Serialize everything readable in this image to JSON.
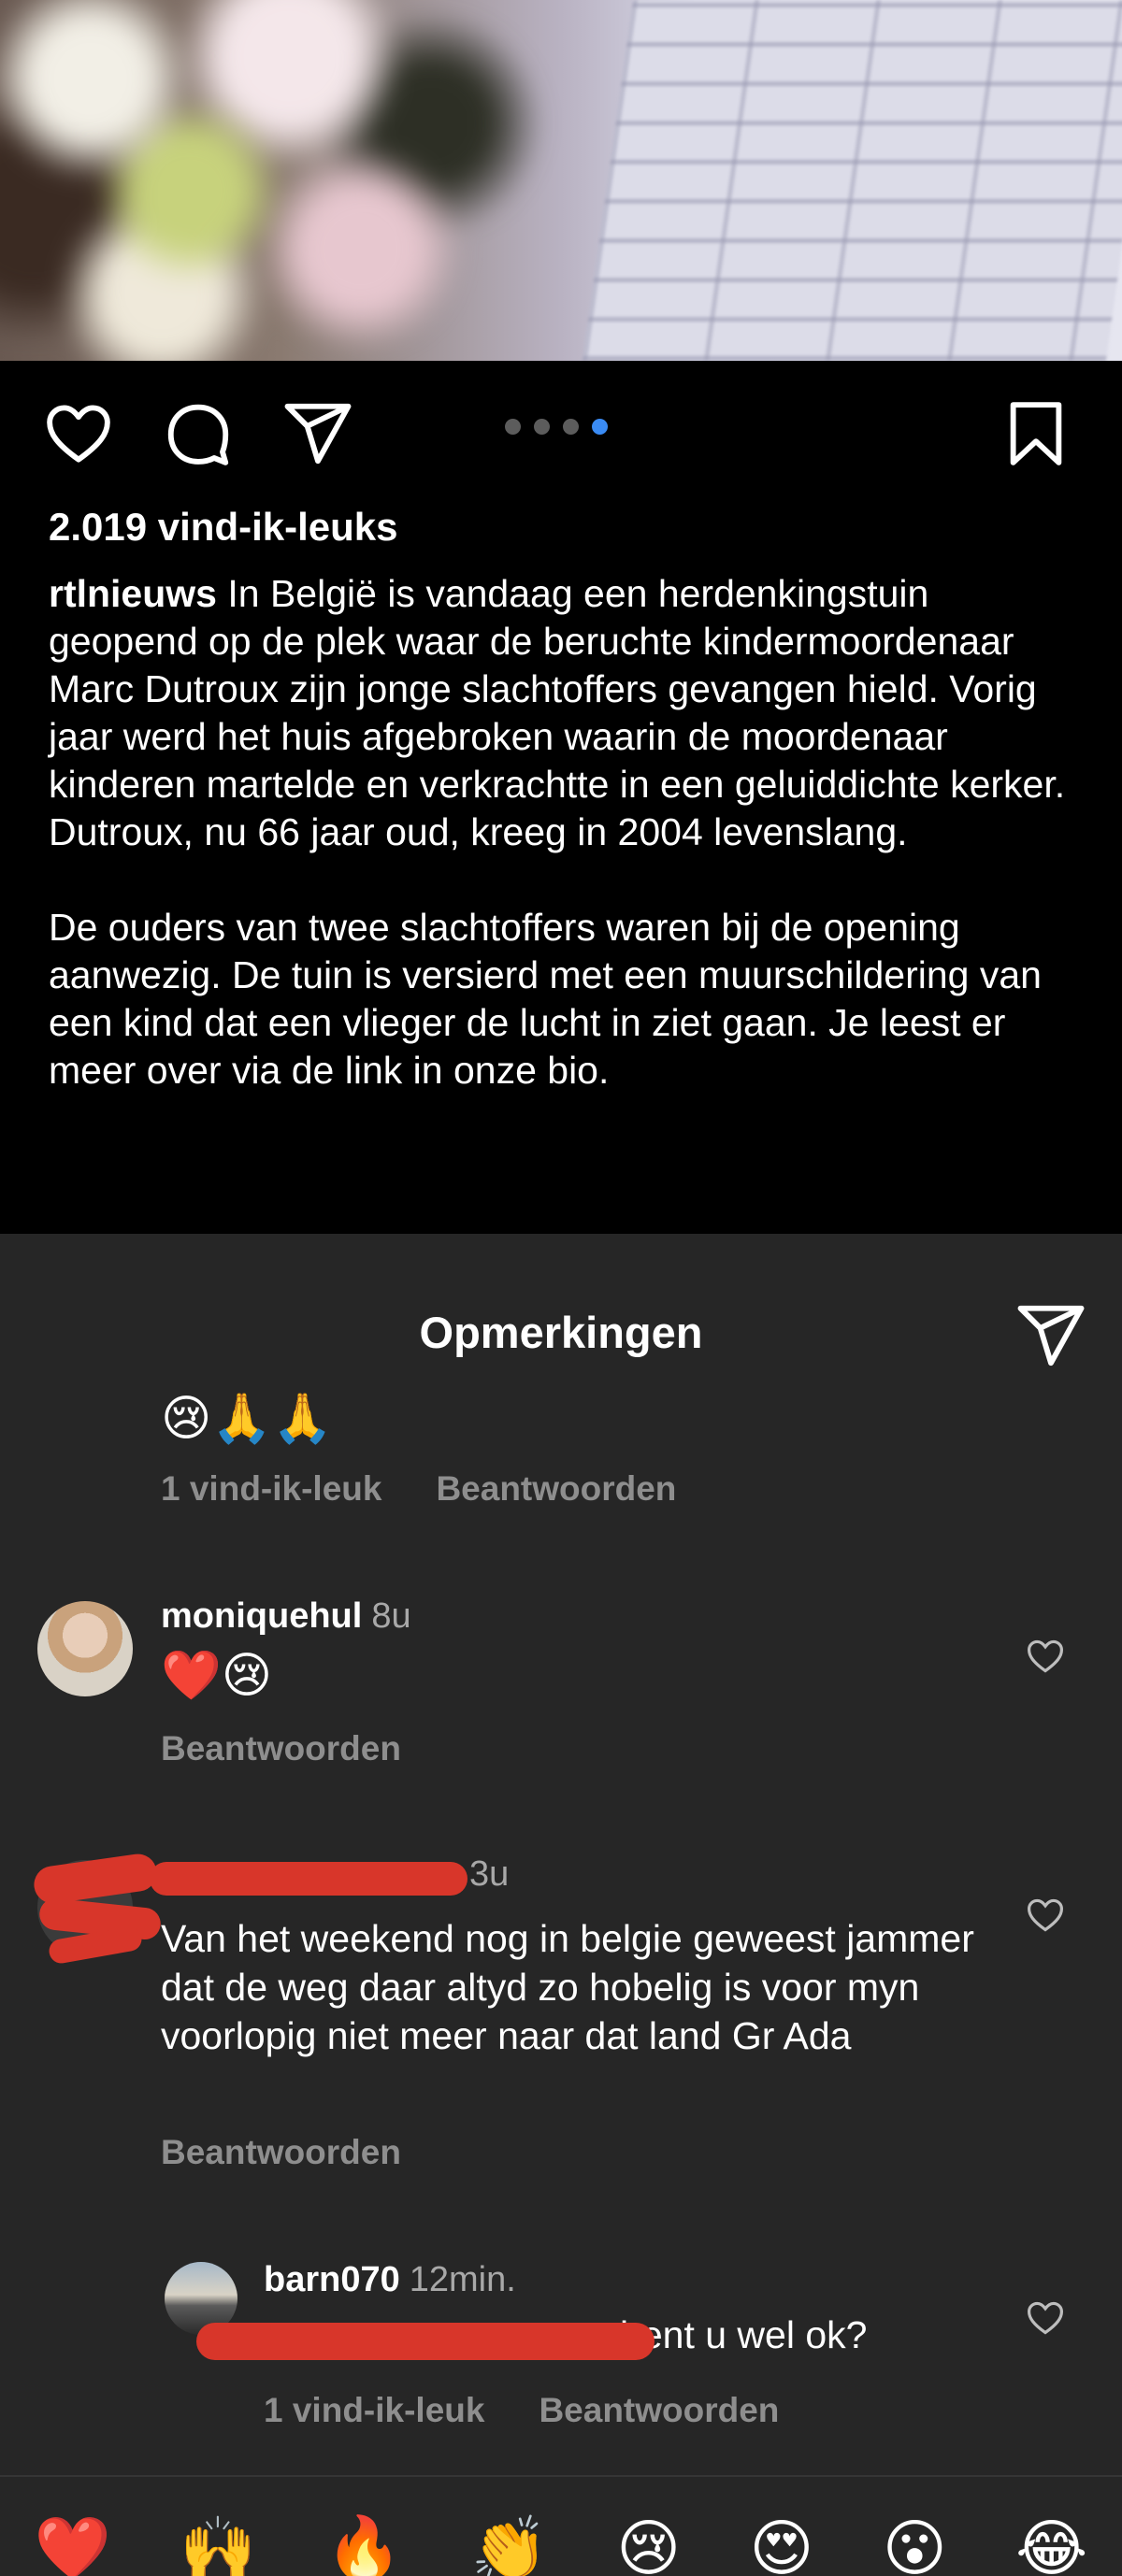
{
  "post": {
    "likes": "2.019 vind-ik-leuks",
    "carousel": {
      "count": 4,
      "active_index": 3
    },
    "caption": {
      "username": "rtlnieuws",
      "paragraph1": " In België is vandaag een herdenkingstuin geopend op de plek waar de beruchte kindermoordenaar Marc Dutroux zijn jonge slachtoffers gevangen hield. Vorig jaar werd het huis afgebroken waarin de moordenaar kinderen martelde en verkrachtte in een geluiddichte kerker. Dutroux, nu 66 jaar oud, kreeg in 2004 levenslang.",
      "paragraph2": "De ouders van twee slachtoffers waren bij de opening aanwezig. De tuin is versierd met een muurschildering van een kind dat een vlieger de lucht in ziet gaan. Je leest er meer over via de link in onze bio."
    }
  },
  "comments_sheet": {
    "title": "Opmerkingen",
    "comments": [
      {
        "text": "😢🙏🙏",
        "likes_label": "1 vind-ik-leuk",
        "reply_label": "Beantwoorden"
      },
      {
        "username": "moniquehul",
        "time": "8u",
        "text": "❤️😢",
        "reply_label": "Beantwoorden"
      },
      {
        "time": "3u",
        "text": "Van het weekend nog in belgie geweest jammer dat de weg daar altyd zo hobelig is voor myn voorlopig niet meer naar dat land Gr Ada",
        "reply_label": "Beantwoorden"
      },
      {
        "username": "barn070",
        "time": "12min.",
        "text": "r bent u wel ok?",
        "likes_label": "1 vind-ik-leuk",
        "reply_label": "Beantwoorden"
      }
    ]
  },
  "reactions": [
    "❤️",
    "🙌",
    "🔥",
    "👏",
    "😢",
    "😍",
    "😮",
    "😂"
  ],
  "colors": {
    "background": "#000000",
    "sheet": "#262626",
    "muted": "#8e8e8e",
    "active_dot": "#3a8bf4",
    "redaction": "#d8362a"
  },
  "icons": [
    "heart-icon",
    "comment-icon",
    "share-icon",
    "bookmark-icon",
    "heart-outline-icon"
  ]
}
